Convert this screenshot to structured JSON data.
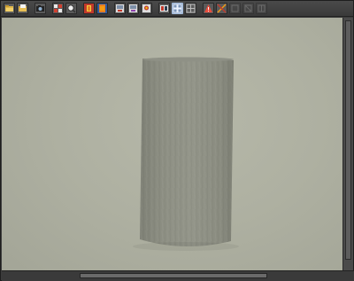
{
  "window": {
    "background": "#3c3c3c"
  },
  "toolbar": {
    "buttons": [
      {
        "name": "open-folder-icon",
        "state": "normal"
      },
      {
        "name": "open-file-icon",
        "state": "normal"
      },
      {
        "name": "camera-icon",
        "state": "normal"
      },
      {
        "name": "grid-layout-icon",
        "state": "normal"
      },
      {
        "name": "zoom-icon",
        "state": "normal"
      },
      {
        "name": "render-red-icon",
        "state": "normal"
      },
      {
        "name": "render-orange-icon",
        "state": "normal"
      },
      {
        "name": "view-front-icon",
        "state": "normal"
      },
      {
        "name": "view-side-icon",
        "state": "normal"
      },
      {
        "name": "view-top-icon",
        "state": "normal"
      },
      {
        "name": "film-strip-icon",
        "state": "normal"
      },
      {
        "name": "layout-quad-icon",
        "state": "active"
      },
      {
        "name": "layout-split-icon",
        "state": "normal"
      },
      {
        "name": "warning-icon",
        "state": "normal"
      },
      {
        "name": "transform-icon",
        "state": "normal"
      },
      {
        "name": "tool-a-icon",
        "state": "disabled"
      },
      {
        "name": "tool-b-icon",
        "state": "disabled"
      },
      {
        "name": "tool-c-icon",
        "state": "disabled"
      }
    ]
  },
  "viewport": {
    "background": "#b1b3a4",
    "object": "cylinder",
    "object_color": "#8b8d80"
  }
}
